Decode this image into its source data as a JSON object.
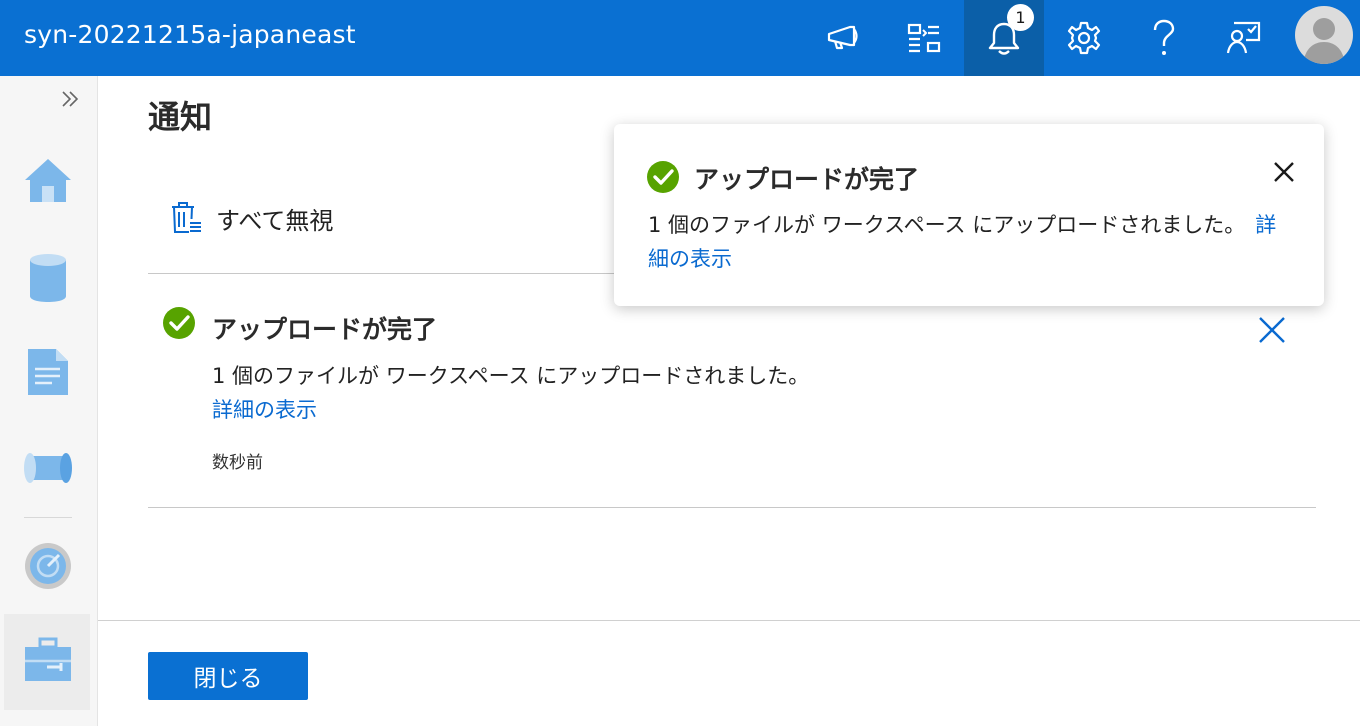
{
  "app": {
    "title": "syn-20221215a-japaneast"
  },
  "header": {
    "notification_count": "1",
    "icons": [
      "megaphone-icon",
      "directory-switch-icon",
      "bell-icon",
      "gear-icon",
      "help-icon",
      "feedback-icon",
      "avatar"
    ]
  },
  "rail": {
    "items": [
      "home-icon",
      "data-icon",
      "develop-icon",
      "integrate-icon",
      "monitor-icon",
      "manage-icon"
    ]
  },
  "panel": {
    "title": "通知",
    "dismiss_all_label": "すべて無視",
    "close_button_label": "閉じる"
  },
  "notification": {
    "title": "アップロードが完了",
    "message": "1 個のファイルが ワークスペース にアップロードされました。",
    "link": "詳細の表示",
    "time": "数秒前"
  },
  "toast": {
    "title": "アップロードが完了",
    "message": "1 個のファイルが ワークスペース にアップロードされました。",
    "link": "詳細の表示"
  },
  "colors": {
    "accent": "#0a70d2",
    "success": "#57a300",
    "link": "#0a6ad0"
  }
}
